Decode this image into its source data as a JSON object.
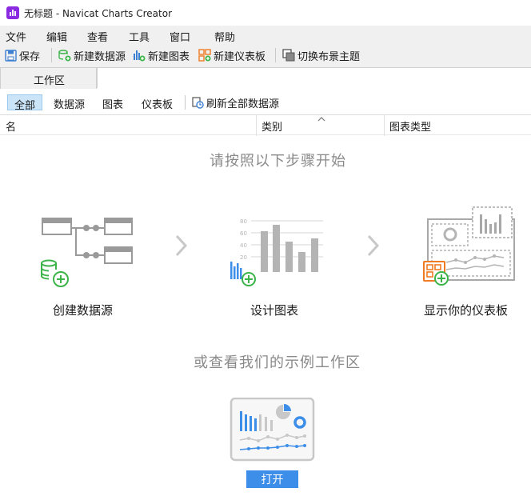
{
  "window": {
    "title": "无标题 - Navicat Charts Creator"
  },
  "menu": [
    "文件",
    "编辑",
    "查看",
    "工具",
    "窗口",
    "帮助"
  ],
  "toolbar": {
    "save": "保存",
    "new_datasource": "新建数据源",
    "new_chart": "新建图表",
    "new_dashboard": "新建仪表板",
    "switch_theme": "切换布景主题"
  },
  "tabs": {
    "workspace": "工作区"
  },
  "filters": {
    "all": "全部",
    "datasource": "数据源",
    "chart": "图表",
    "dashboard": "仪表板",
    "refresh": "刷新全部数据源"
  },
  "columns": {
    "name": "名",
    "category": "类别",
    "chart_type": "图表类型"
  },
  "content": {
    "start_heading": "请按照以下步骤开始",
    "steps": [
      "创建数据源",
      "设计图表",
      "显示你的仪表板"
    ],
    "example_heading": "或查看我们的示例工作区",
    "open_button": "打开"
  },
  "chart_axis_ticks": [
    "80",
    "60",
    "40",
    "20"
  ],
  "colors": {
    "accent": "#3d8ee8",
    "green": "#3cb44a",
    "orange": "#f07b22",
    "gray": "#b4b4b4"
  }
}
